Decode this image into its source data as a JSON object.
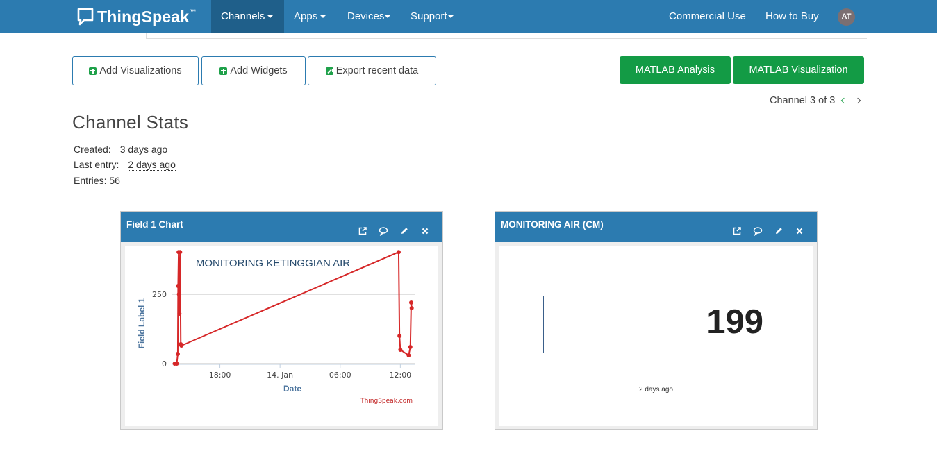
{
  "navbar": {
    "brand": "ThingSpeak",
    "brand_tm": "™",
    "channels": "Channels",
    "apps": "Apps",
    "devices": "Devices",
    "support": "Support",
    "commercial_use": "Commercial Use",
    "how_to_buy": "How to Buy",
    "avatar_initials": "AT"
  },
  "toolbar": {
    "add_visualizations": "Add Visualizations",
    "add_widgets": "Add Widgets",
    "export_recent_data": "Export recent data",
    "matlab_analysis": "MATLAB Analysis",
    "matlab_visualization": "MATLAB Visualization",
    "pager": "Channel 3 of 3"
  },
  "stats": {
    "title": "Channel Stats",
    "created_label": "Created:",
    "created_value": "3 days ago",
    "last_entry_label": "Last entry:",
    "last_entry_value": "2 days ago",
    "entries": "Entries: 56"
  },
  "panel_chart": {
    "title": "Field 1 Chart"
  },
  "panel_display": {
    "title": "MONITORING AIR (CM)",
    "value": "199",
    "time": "2 days ago"
  },
  "colors": {
    "navbar": "#2c7bb0",
    "green": "#139b45",
    "series": "#d62728"
  },
  "chart_data": {
    "type": "line",
    "title": "MONITORING KETINGGIAN AIR",
    "xlabel": "Date",
    "ylabel": "Field Label 1",
    "credit": "ThingSpeak.com",
    "x_tick_labels": [
      "18:00",
      "14. Jan",
      "06:00",
      "12:00"
    ],
    "y_tick_labels": [
      "0",
      "250"
    ],
    "ylim": [
      0,
      350
    ],
    "xlim": [
      "2024-01-13 13:15",
      "2024-01-14 13:30"
    ],
    "grid": true,
    "series": [
      {
        "values": [
          [
            "2024-01-13 13:30",
            0
          ],
          [
            "2024-01-13 13:42",
            0
          ],
          [
            "2024-01-13 13:48",
            35
          ],
          [
            "2024-01-13 13:50",
            280
          ],
          [
            "2024-01-13 13:53",
            402
          ],
          [
            "2024-01-13 13:55",
            250
          ],
          [
            "2024-01-13 13:58",
            180
          ],
          [
            "2024-01-13 14:02",
            402
          ],
          [
            "2024-01-13 14:06",
            70
          ],
          [
            "2024-01-13 14:10",
            65
          ],
          [
            "2024-01-14 11:50",
            402
          ],
          [
            "2024-01-14 11:55",
            100
          ],
          [
            "2024-01-14 12:00",
            50
          ],
          [
            "2024-01-14 12:50",
            30
          ],
          [
            "2024-01-14 13:00",
            60
          ],
          [
            "2024-01-14 13:05",
            220
          ],
          [
            "2024-01-14 13:08",
            200
          ]
        ]
      }
    ]
  }
}
